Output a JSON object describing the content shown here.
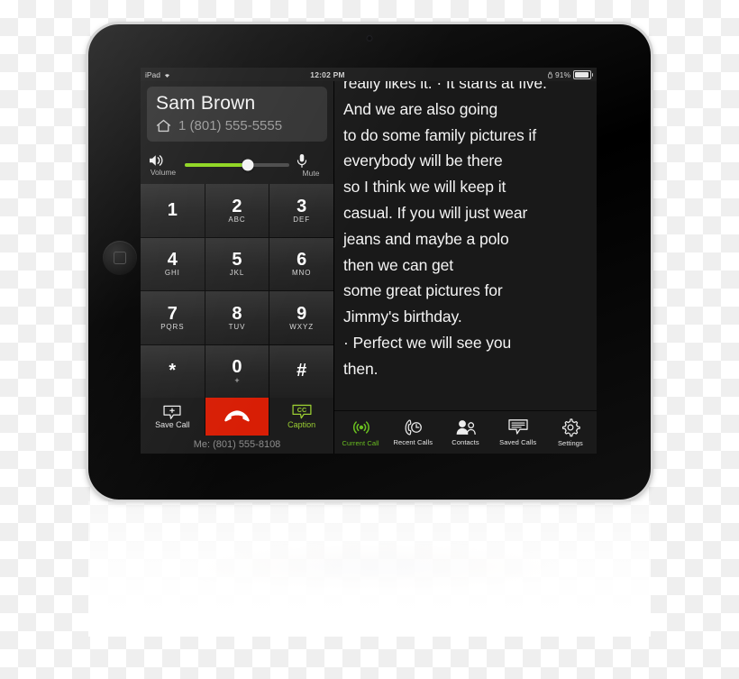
{
  "device": {
    "kind": "tablet",
    "home_button": "home-button",
    "camera": "front-camera"
  },
  "status_bar": {
    "carrier": "iPad",
    "wifi_icon": "wifi-icon",
    "time": "12:02 PM",
    "lock_icon": "portrait-lock-icon",
    "battery_percent": "91%",
    "battery_icon": "battery-icon"
  },
  "call": {
    "contact_name": "Sam Brown",
    "number_type_icon": "home-icon",
    "contact_number": "1 (801) 555-5555",
    "my_number_line": "Me: (801) 555-8108"
  },
  "volume": {
    "speaker_icon": "speaker-icon",
    "label": "Volume",
    "level_percent": 60,
    "mic_icon": "microphone-icon",
    "mute_label": "Mute",
    "fill_color": "#8ed61f"
  },
  "keypad": {
    "keys": [
      {
        "digit": "1",
        "letters": ""
      },
      {
        "digit": "2",
        "letters": "ABC"
      },
      {
        "digit": "3",
        "letters": "DEF"
      },
      {
        "digit": "4",
        "letters": "GHI"
      },
      {
        "digit": "5",
        "letters": "JKL"
      },
      {
        "digit": "6",
        "letters": "MNO"
      },
      {
        "digit": "7",
        "letters": "PQRS"
      },
      {
        "digit": "8",
        "letters": "TUV"
      },
      {
        "digit": "9",
        "letters": "WXYZ"
      },
      {
        "digit": "*",
        "letters": ""
      },
      {
        "digit": "0",
        "letters": "+"
      },
      {
        "digit": "#",
        "letters": ""
      }
    ]
  },
  "actions": {
    "save_call": {
      "label": "Save Call",
      "icon": "save-call-bubble-icon"
    },
    "end_call": {
      "label": "",
      "icon": "end-call-handset-icon",
      "color": "#d81e05"
    },
    "caption": {
      "label": "Caption",
      "icon": "cc-icon",
      "color": "#9acd32"
    }
  },
  "caption": {
    "lines": [
      "really likes it.  · It starts at five.",
      "And we are also going",
      "to do some family pictures if",
      "everybody will be there",
      "so I think we will keep it",
      "casual. If you will just wear",
      "jeans and maybe a polo",
      "then we can get",
      "some great pictures  for",
      "Jimmy's birthday.",
      " · Perfect we will see you",
      "then."
    ]
  },
  "tabbar": {
    "active_color": "#6abf20",
    "tabs": [
      {
        "label": "Current Call",
        "icon": "current-call-icon",
        "active": true
      },
      {
        "label": "Recent Calls",
        "icon": "recent-calls-icon",
        "active": false
      },
      {
        "label": "Contacts",
        "icon": "contacts-icon",
        "active": false
      },
      {
        "label": "Saved Calls",
        "icon": "saved-calls-icon",
        "active": false
      },
      {
        "label": "Settings",
        "icon": "settings-gear-icon",
        "active": false
      }
    ]
  }
}
